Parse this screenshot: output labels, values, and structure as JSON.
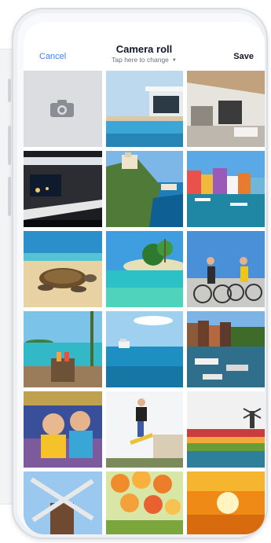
{
  "header": {
    "cancel_label": "Cancel",
    "title": "Camera roll",
    "subtitle": "Tap here to change",
    "save_label": "Save"
  },
  "photos": [
    {
      "name": "photo-camera-capture"
    },
    {
      "name": "photo-pool-villa"
    },
    {
      "name": "photo-living-room"
    },
    {
      "name": "photo-modern-house-night"
    },
    {
      "name": "photo-coastal-cliff-town"
    },
    {
      "name": "photo-harbor-colorful-houses"
    },
    {
      "name": "photo-sea-turtle-beach"
    },
    {
      "name": "photo-tropical-island"
    },
    {
      "name": "photo-family-cycling"
    },
    {
      "name": "photo-beach-drinks"
    },
    {
      "name": "photo-cruise-ship"
    },
    {
      "name": "photo-canal-boats"
    },
    {
      "name": "photo-kids-carousel"
    },
    {
      "name": "photo-skateboard-jump"
    },
    {
      "name": "photo-tulip-windmill"
    },
    {
      "name": "photo-windmill-closeup"
    },
    {
      "name": "photo-flower-bouquet"
    },
    {
      "name": "photo-sunset"
    }
  ]
}
